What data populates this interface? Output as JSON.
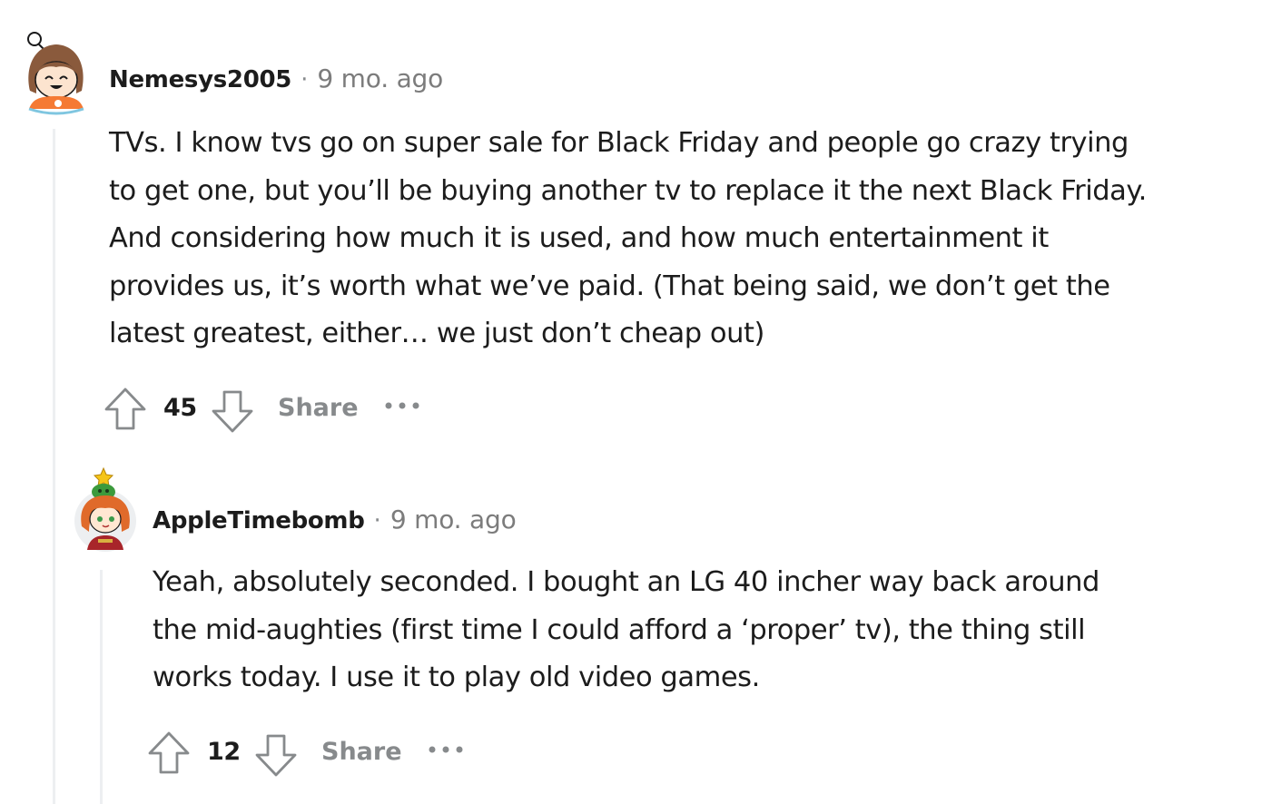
{
  "comments": [
    {
      "author": "Nemesys2005",
      "separator": "·",
      "time": "9 mo. ago",
      "lines": [
        "TVs. I know tvs go on super sale for Black Friday and people go crazy trying",
        "to get one, but you’ll be buying another tv to replace it the next Black Friday.",
        "And considering how much it is used, and how much entertainment it",
        "provides us, it’s worth what we’ve paid. (That being said, we don’t get the",
        "latest greatest, either… we just don’t cheap out)"
      ],
      "votes": "45",
      "share_label": "Share",
      "more_label": "more options"
    },
    {
      "author": "AppleTimebomb",
      "separator": "·",
      "time": "9 mo. ago",
      "lines": [
        "Yeah, absolutely seconded. I bought an LG 40 incher way back around",
        "the mid-aughties (first time I could afford a ‘proper’ tv), the thing still",
        "works today. I use it to play old video games."
      ],
      "votes": "12",
      "share_label": "Share",
      "more_label": "more options"
    }
  ],
  "icons": {
    "upvote": "arrow-up-outline-icon",
    "downvote": "arrow-down-outline-icon",
    "more": "horizontal-ellipsis-icon"
  },
  "colors": {
    "text": "#1c1c1c",
    "meta": "#7c7c7c",
    "action": "#878a8c",
    "thread_line": "#edeff1"
  }
}
